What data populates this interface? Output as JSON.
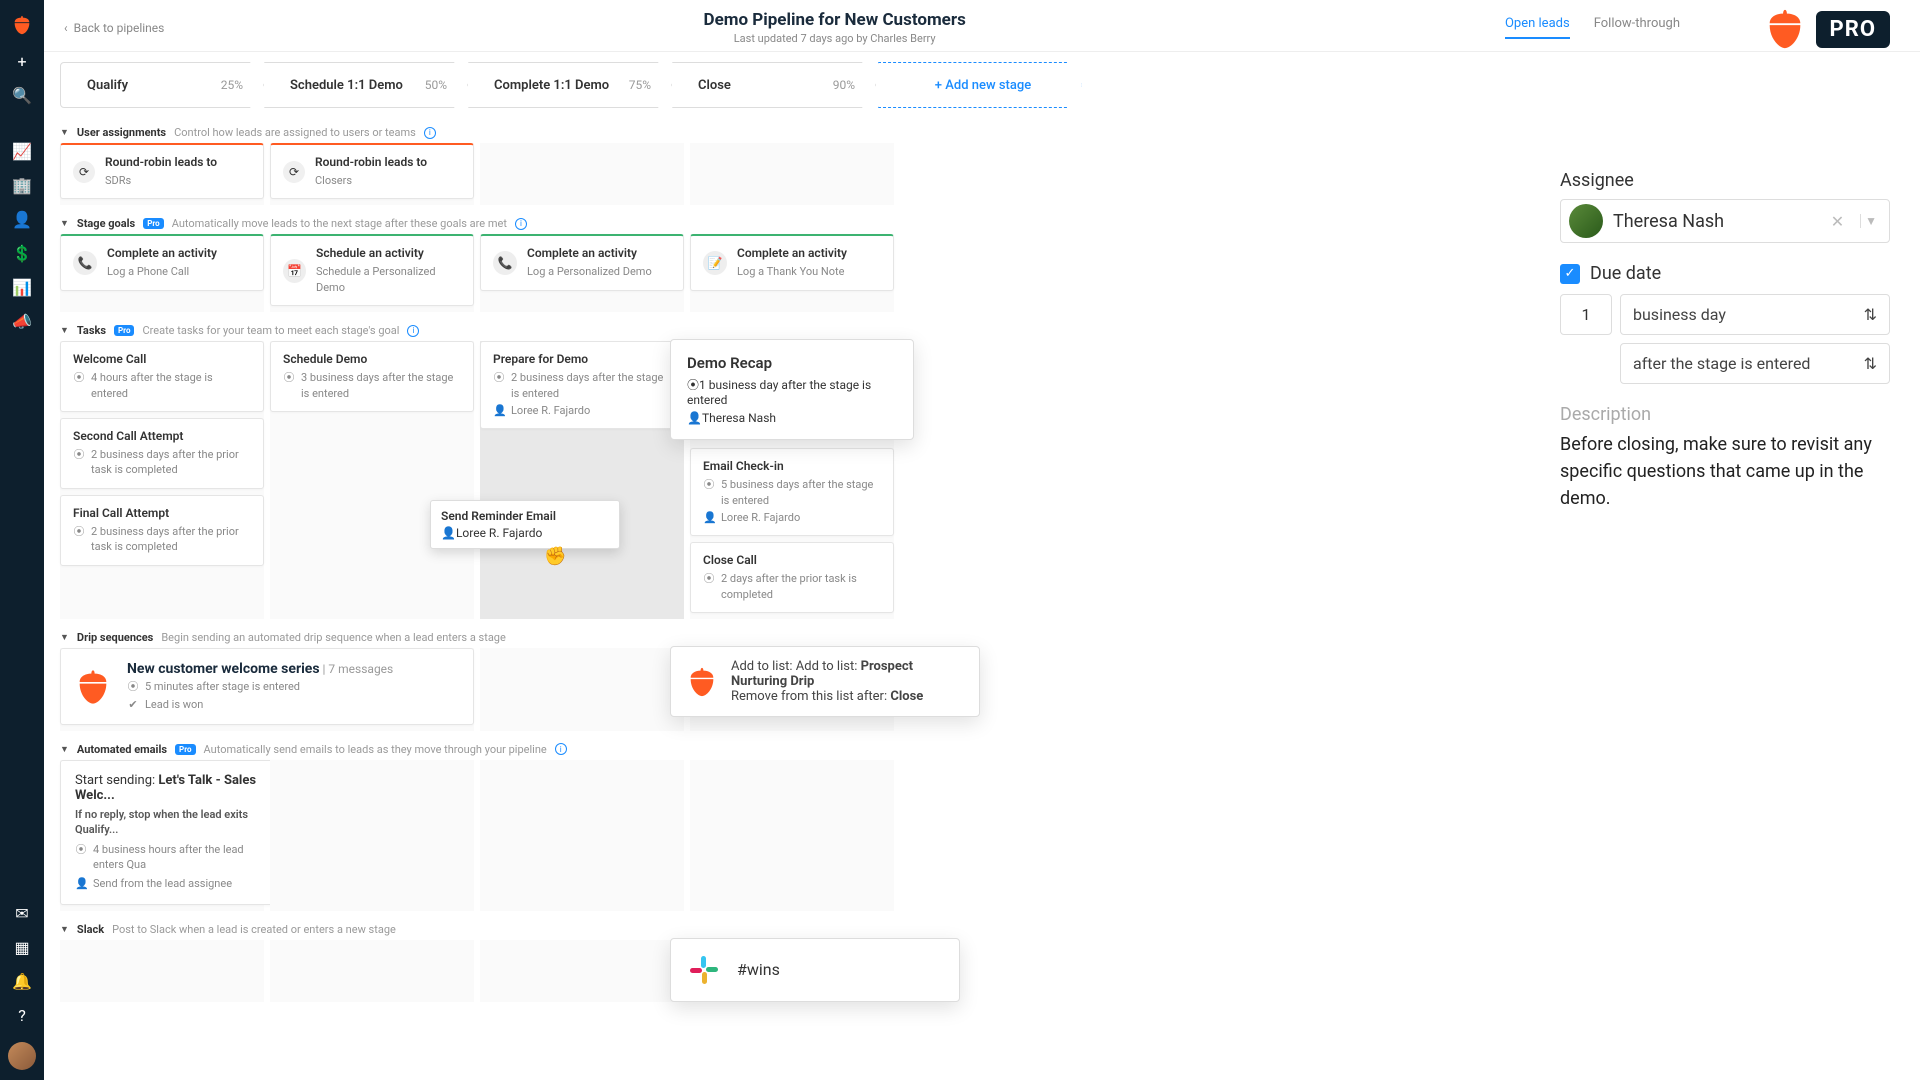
{
  "header": {
    "back_label": "Back to pipelines",
    "title": "Demo Pipeline for New Customers",
    "subtitle": "Last updated 7 days ago by Charles Berry",
    "tab_open": "Open leads",
    "tab_follow": "Follow-through"
  },
  "pro_badge": "PRO",
  "stages": [
    {
      "name": "Qualify",
      "pct": "25%"
    },
    {
      "name": "Schedule 1:1 Demo",
      "pct": "50%"
    },
    {
      "name": "Complete 1:1 Demo",
      "pct": "75%"
    },
    {
      "name": "Close",
      "pct": "90%"
    }
  ],
  "add_stage_label": "+ Add new stage",
  "sections": {
    "user_assignments": {
      "name": "User assignments",
      "desc": "Control how leads are assigned to users or teams"
    },
    "stage_goals": {
      "name": "Stage goals",
      "desc": "Automatically move leads to the next stage after these goals are met"
    },
    "tasks": {
      "name": "Tasks",
      "desc": "Create tasks for your team to meet each stage's goal"
    },
    "drip": {
      "name": "Drip sequences",
      "desc": "Begin sending an automated drip sequence when a lead enters a stage"
    },
    "auto_emails": {
      "name": "Automated emails",
      "desc": "Automatically send emails to leads as they move through your pipeline"
    },
    "slack": {
      "name": "Slack",
      "desc": "Post to Slack when a lead is created or enters a new stage"
    }
  },
  "round_robin": {
    "label": "Round-robin leads to",
    "sdrs": "SDRs",
    "closers": "Closers"
  },
  "goals": {
    "complete": "Complete an activity",
    "schedule": "Schedule an activity",
    "phone": "Log a Phone Call",
    "demo_sched": "Schedule a Personalized Demo",
    "demo_log": "Log a Personalized Demo",
    "thank_you": "Log a Thank You Note"
  },
  "tasks": {
    "welcome": {
      "title": "Welcome Call",
      "sub": "4 hours after the stage is entered"
    },
    "second": {
      "title": "Second Call Attempt",
      "sub": "2 business days after the prior task is completed"
    },
    "final": {
      "title": "Final Call Attempt",
      "sub": "2 business days after the prior task is completed"
    },
    "sched_demo": {
      "title": "Schedule Demo",
      "sub": "3 business days after the stage is entered"
    },
    "prepare": {
      "title": "Prepare for Demo",
      "sub": "2 business days after the stage is entered",
      "person": "Loree R. Fajardo"
    },
    "reminder": {
      "title": "Send Reminder Email",
      "person": "Loree R. Fajardo"
    },
    "recap": {
      "title": "Demo Recap",
      "sub": "1 business day after the stage is entered",
      "person": "Theresa Nash"
    },
    "checkin": {
      "title": "Email Check-in",
      "sub": "5 business days after the stage is entered",
      "person": "Loree R. Fajardo"
    },
    "close_call": {
      "title": "Close Call",
      "sub": "2 days after the prior task is completed"
    }
  },
  "drip": {
    "title": "New customer welcome series",
    "msgs": "| 7 messages",
    "sub1": "5 minutes after stage is entered",
    "sub2": "Lead is won",
    "add_prefix": "Add to list: ",
    "add_list": "Prospect Nurturing Drip",
    "remove_prefix": "Remove from this list after: ",
    "remove_after": "Close"
  },
  "auto_email": {
    "title_prefix": "Start sending: ",
    "title_bold": "Let's Talk - Sales Welc...",
    "stop": "If no reply, stop when the lead exits Qualify...",
    "timing": "4 business hours after the lead enters Qua",
    "from": "Send from the lead assignee"
  },
  "slack_channel": "#wins",
  "panel": {
    "assignee_label": "Assignee",
    "assignee_name": "Theresa Nash",
    "due_label": "Due date",
    "num": "1",
    "unit": "business day",
    "trigger": "after the stage is entered",
    "desc_label": "Description",
    "desc_text": "Before closing, make sure to revisit any specific questions that came up in the demo."
  }
}
